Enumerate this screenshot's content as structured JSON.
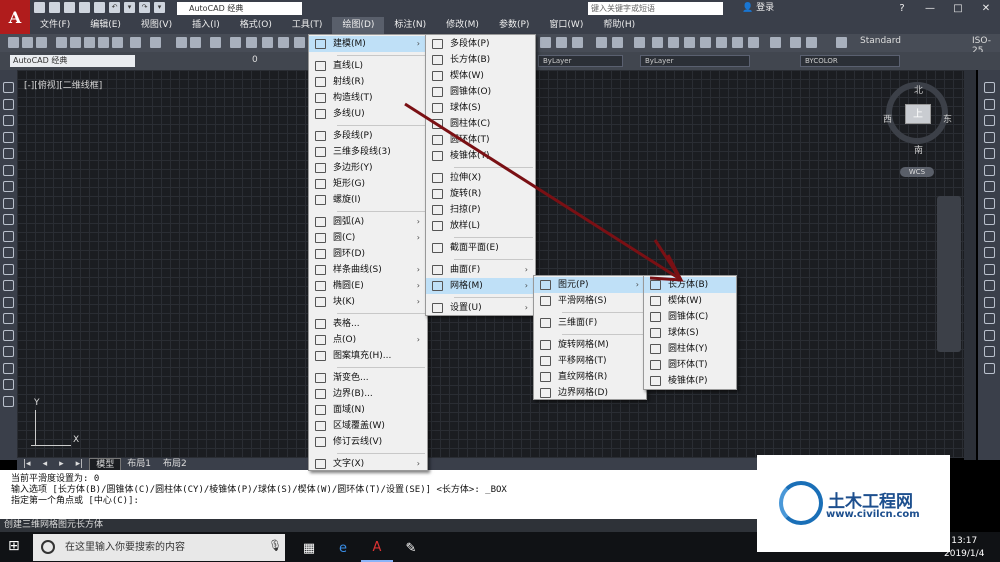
{
  "titlebar": {
    "logo": "A",
    "workspace": "AutoCAD 经典",
    "search_placeholder": "键入关键字或短语",
    "login": "登录",
    "win_min": "—",
    "win_max": "□",
    "win_close": "✕"
  },
  "menubar": [
    "文件(F)",
    "编辑(E)",
    "视图(V)",
    "插入(I)",
    "格式(O)",
    "工具(T)",
    "绘图(D)",
    "标注(N)",
    "修改(M)",
    "参数(P)",
    "窗口(W)",
    "帮助(H)"
  ],
  "active_menu": "绘图(D)",
  "toolbar": {
    "text_style": "Standard",
    "dim_style": "ISO-25",
    "workspace2": "AutoCAD 经典",
    "layer": "0",
    "color": "ByLayer",
    "linetype": "ByLayer",
    "lineweight": "BYCOLOR"
  },
  "viewport": {
    "label": "[-][俯视][二维线框]",
    "compass": {
      "n": "北",
      "s": "南",
      "e": "东",
      "w": "西",
      "top": "上"
    },
    "wcs": "WCS",
    "ucs_x": "X",
    "ucs_y": "Y"
  },
  "tabs": [
    "模型",
    "布局1",
    "布局2"
  ],
  "command_lines": [
    "当前平滑度设置为: 0",
    "输入选项 [长方体(B)/圆锥体(C)/圆柱体(CY)/棱锥体(P)/球体(S)/楔体(W)/圆环体(T)/设置(SE)] <长方体>: _BOX",
    "",
    "指定第一个角点或 [中心(C)]:"
  ],
  "status": "创建三维网格图元长方体",
  "draw_menu": [
    {
      "label": "建模(M)",
      "sub": true,
      "hl": true
    },
    {
      "label": "直线(L)"
    },
    {
      "label": "射线(R)"
    },
    {
      "label": "构造线(T)"
    },
    {
      "label": "多线(U)"
    },
    {
      "label": "多段线(P)"
    },
    {
      "label": "三维多段线(3)"
    },
    {
      "label": "多边形(Y)"
    },
    {
      "label": "矩形(G)"
    },
    {
      "label": "螺旋(I)"
    },
    {
      "label": "圆弧(A)",
      "sub": true
    },
    {
      "label": "圆(C)",
      "sub": true
    },
    {
      "label": "圆环(D)"
    },
    {
      "label": "样条曲线(S)",
      "sub": true
    },
    {
      "label": "椭圆(E)",
      "sub": true
    },
    {
      "label": "块(K)",
      "sub": true
    },
    {
      "label": "表格..."
    },
    {
      "label": "点(O)",
      "sub": true
    },
    {
      "label": "图案填充(H)..."
    },
    {
      "label": "渐变色..."
    },
    {
      "label": "边界(B)..."
    },
    {
      "label": "面域(N)"
    },
    {
      "label": "区域覆盖(W)"
    },
    {
      "label": "修订云线(V)"
    },
    {
      "label": "文字(X)",
      "sub": true
    }
  ],
  "modeling_menu": [
    {
      "label": "多段体(P)"
    },
    {
      "label": "长方体(B)"
    },
    {
      "label": "楔体(W)"
    },
    {
      "label": "圆锥体(O)"
    },
    {
      "label": "球体(S)"
    },
    {
      "label": "圆柱体(C)"
    },
    {
      "label": "圆环体(T)"
    },
    {
      "label": "棱锥体(Y)"
    },
    {
      "label": "拉伸(X)"
    },
    {
      "label": "旋转(R)"
    },
    {
      "label": "扫掠(P)"
    },
    {
      "label": "放样(L)"
    },
    {
      "label": "截面平面(E)"
    },
    {
      "label": "曲面(F)",
      "sub": true
    },
    {
      "label": "网格(M)",
      "sub": true,
      "hl": true
    },
    {
      "label": "设置(U)",
      "sub": true
    }
  ],
  "mesh_menu": [
    {
      "label": "图元(P)",
      "sub": true,
      "hl": true
    },
    {
      "label": "平滑网格(S)"
    },
    {
      "label": "三维面(F)"
    },
    {
      "label": "旋转网格(M)"
    },
    {
      "label": "平移网格(T)"
    },
    {
      "label": "直纹网格(R)"
    },
    {
      "label": "边界网格(D)"
    }
  ],
  "primitives_menu": [
    {
      "label": "长方体(B)",
      "hl": true
    },
    {
      "label": "楔体(W)"
    },
    {
      "label": "圆锥体(C)"
    },
    {
      "label": "球体(S)"
    },
    {
      "label": "圆柱体(Y)"
    },
    {
      "label": "圆环体(T)"
    },
    {
      "label": "棱锥体(P)"
    }
  ],
  "taskbar": {
    "search": "在这里输入你要搜索的内容",
    "time": "13:17",
    "date": "2019/1/4"
  },
  "watermark": {
    "title": "土木工程网",
    "url": "www.civilcn.com"
  },
  "colors": {
    "accent": "#b01c1c",
    "highlight": "#bfe0f7",
    "arrow": "#7a1014"
  }
}
